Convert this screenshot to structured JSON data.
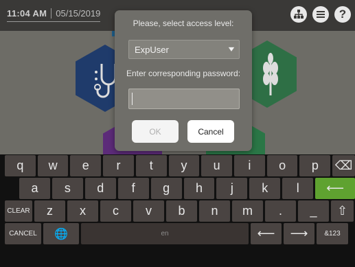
{
  "topbar": {
    "time": "11:04 AM",
    "date": "05/15/2019",
    "icons": [
      "network-icon",
      "menu-icon",
      "help-icon"
    ]
  },
  "dialog": {
    "title": "Please, select access level:",
    "access_level": "ExpUser",
    "password_label": "Enter corresponding password:",
    "password_value": "",
    "ok_label": "OK",
    "cancel_label": "Cancel"
  },
  "keyboard": {
    "row1": [
      "q",
      "w",
      "e",
      "r",
      "t",
      "y",
      "u",
      "i",
      "o",
      "p"
    ],
    "row2": [
      "a",
      "s",
      "d",
      "f",
      "g",
      "h",
      "j",
      "k",
      "l"
    ],
    "row3": [
      "z",
      "x",
      "c",
      "v",
      "b",
      "n",
      "m",
      ".",
      "_"
    ],
    "clear_label": "CLEAR",
    "cancel_label": "CANCEL",
    "space_label": "en",
    "numeric_label": "&123",
    "backspace_symbol": "⌫",
    "enter_symbol": "⟵",
    "shift_symbol": "⇧",
    "left_symbol": "⟵",
    "right_symbol": "⟶",
    "globe_symbol": "🌐"
  },
  "colors": {
    "enter_key": "#5fa230",
    "key_bg": "#4a4442",
    "dialog_bg": "#6f6e69"
  }
}
